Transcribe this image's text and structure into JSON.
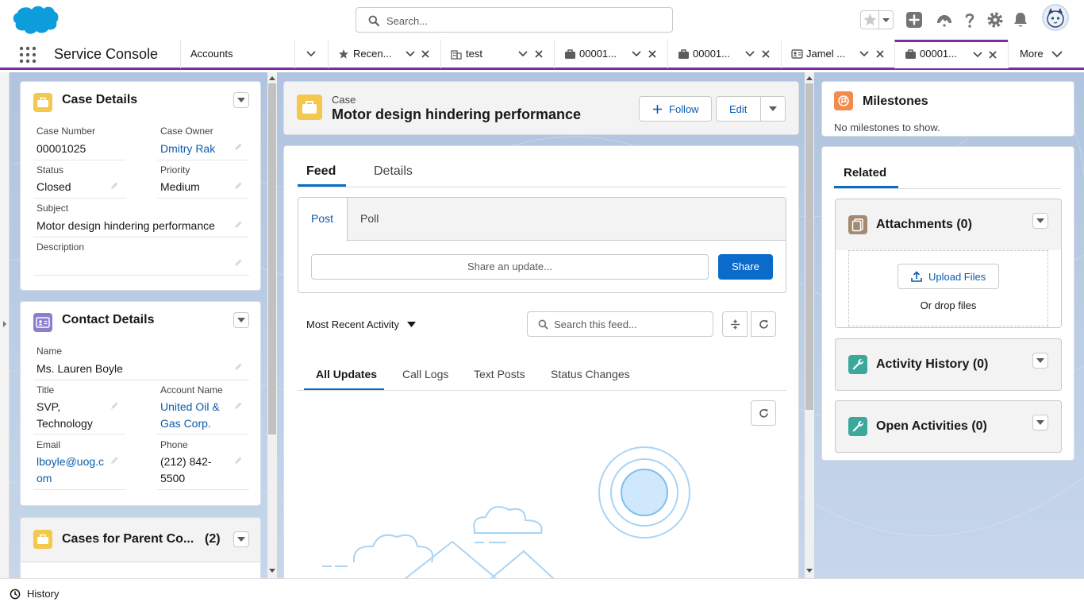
{
  "header": {
    "search_placeholder": "Search..."
  },
  "nav": {
    "app_name": "Service Console",
    "tabs": [
      {
        "label": "Accounts"
      },
      {
        "label": "Recen..."
      },
      {
        "label": "test"
      },
      {
        "label": "00001..."
      },
      {
        "label": "00001..."
      },
      {
        "label": "Jamel ..."
      },
      {
        "label": "00001..."
      }
    ],
    "more_label": "More"
  },
  "case_details": {
    "title": "Case Details",
    "case_number_label": "Case Number",
    "case_number": "00001025",
    "case_owner_label": "Case Owner",
    "case_owner": "Dmitry Rak",
    "status_label": "Status",
    "status": "Closed",
    "priority_label": "Priority",
    "priority": "Medium",
    "subject_label": "Subject",
    "subject": "Motor design hindering performance",
    "description_label": "Description"
  },
  "contact_details": {
    "title": "Contact Details",
    "name_label": "Name",
    "name": "Ms. Lauren Boyle",
    "title_label": "Title",
    "title_line1": "SVP,",
    "title_line2": "Technology",
    "account_label": "Account Name",
    "account_line1": "United Oil &",
    "account_line2": "Gas Corp.",
    "email_label": "Email",
    "email_line1": "lboyle@uog.c",
    "email_line2": "om",
    "phone_label": "Phone",
    "phone_line1": "(212) 842-",
    "phone_line2": "5500"
  },
  "cases_parent": {
    "title": "Cases for Parent Co...",
    "count": "(2)"
  },
  "case_header": {
    "object_label": "Case",
    "title": "Motor design hindering performance",
    "follow_label": "Follow",
    "edit_label": "Edit"
  },
  "feed": {
    "tabs": [
      "Feed",
      "Details"
    ],
    "publisher_tabs": [
      "Post",
      "Poll"
    ],
    "share_placeholder": "Share an update...",
    "share_button": "Share",
    "sort_label": "Most Recent Activity",
    "search_placeholder": "Search this feed...",
    "filter_tabs": [
      "All Updates",
      "Call Logs",
      "Text Posts",
      "Status Changes"
    ]
  },
  "milestones": {
    "title": "Milestones",
    "empty_text": "No milestones to show."
  },
  "related": {
    "tab_label": "Related",
    "attachments_title": "Attachments (0)",
    "upload_label": "Upload Files",
    "drop_label": "Or drop files",
    "activity_history_title": "Activity History (0)",
    "open_activities_title": "Open Activities (0)"
  },
  "utility": {
    "history_label": "History"
  },
  "colors": {
    "brand": "#0b6bcb",
    "link": "#0b5cab",
    "active_tab_accent": "#7f2ca2",
    "case_icon": "#f4c84c",
    "contact_icon": "#8b7fcf",
    "milestone_icon": "#f38b4a",
    "attachment_icon": "#a48a6e",
    "activity_icon": "#3ba89b"
  }
}
